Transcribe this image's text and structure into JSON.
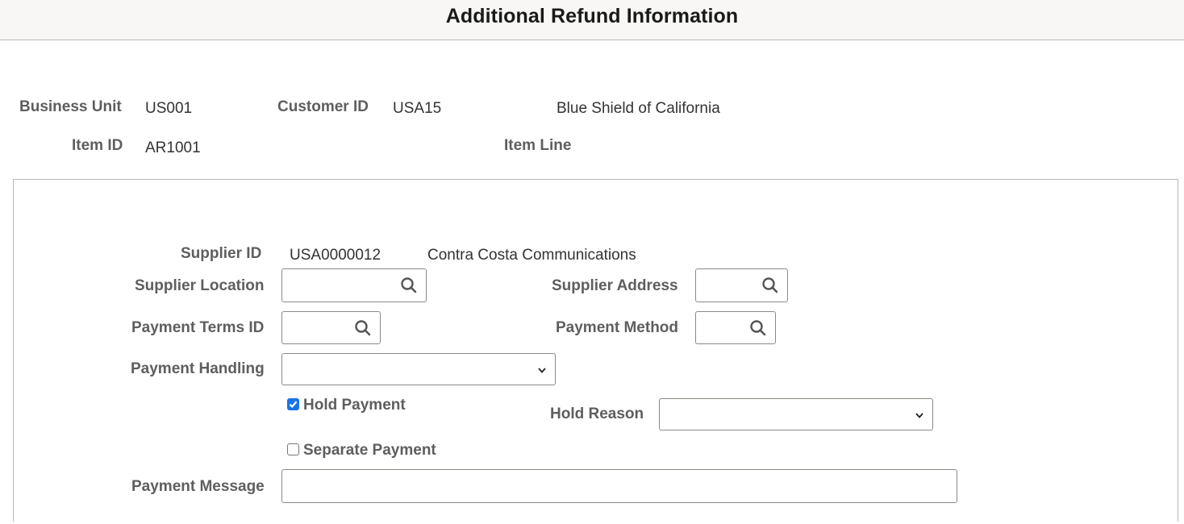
{
  "header": {
    "title": "Additional Refund Information"
  },
  "summary": {
    "business_unit_label": "Business Unit",
    "business_unit_value": "US001",
    "customer_id_label": "Customer ID",
    "customer_id_value": "USA15",
    "customer_name": "Blue Shield of California",
    "item_id_label": "Item ID",
    "item_id_value": "AR1001",
    "item_line_label": "Item Line",
    "item_line_value": ""
  },
  "supplier": {
    "supplier_id_label": "Supplier ID",
    "supplier_id_value": "USA0000012",
    "supplier_name": "Contra Costa Communications",
    "supplier_location_label": "Supplier Location",
    "supplier_location_value": "",
    "supplier_address_label": "Supplier Address",
    "supplier_address_value": "",
    "payment_terms_label": "Payment Terms ID",
    "payment_terms_value": "",
    "payment_method_label": "Payment Method",
    "payment_method_value": "",
    "payment_handling_label": "Payment Handling",
    "payment_handling_value": "",
    "hold_payment_label": "Hold Payment",
    "hold_payment_checked": true,
    "hold_reason_label": "Hold Reason",
    "hold_reason_value": "",
    "separate_payment_label": "Separate Payment",
    "separate_payment_checked": false,
    "payment_message_label": "Payment Message",
    "payment_message_value": ""
  },
  "icons": {
    "lookup": "search-icon",
    "dropdown": "chevron-down-icon",
    "check": "checkmark-icon"
  },
  "colors": {
    "accent": "#1a73e8",
    "label": "#5e5e5e",
    "border": "#8e8a85"
  }
}
